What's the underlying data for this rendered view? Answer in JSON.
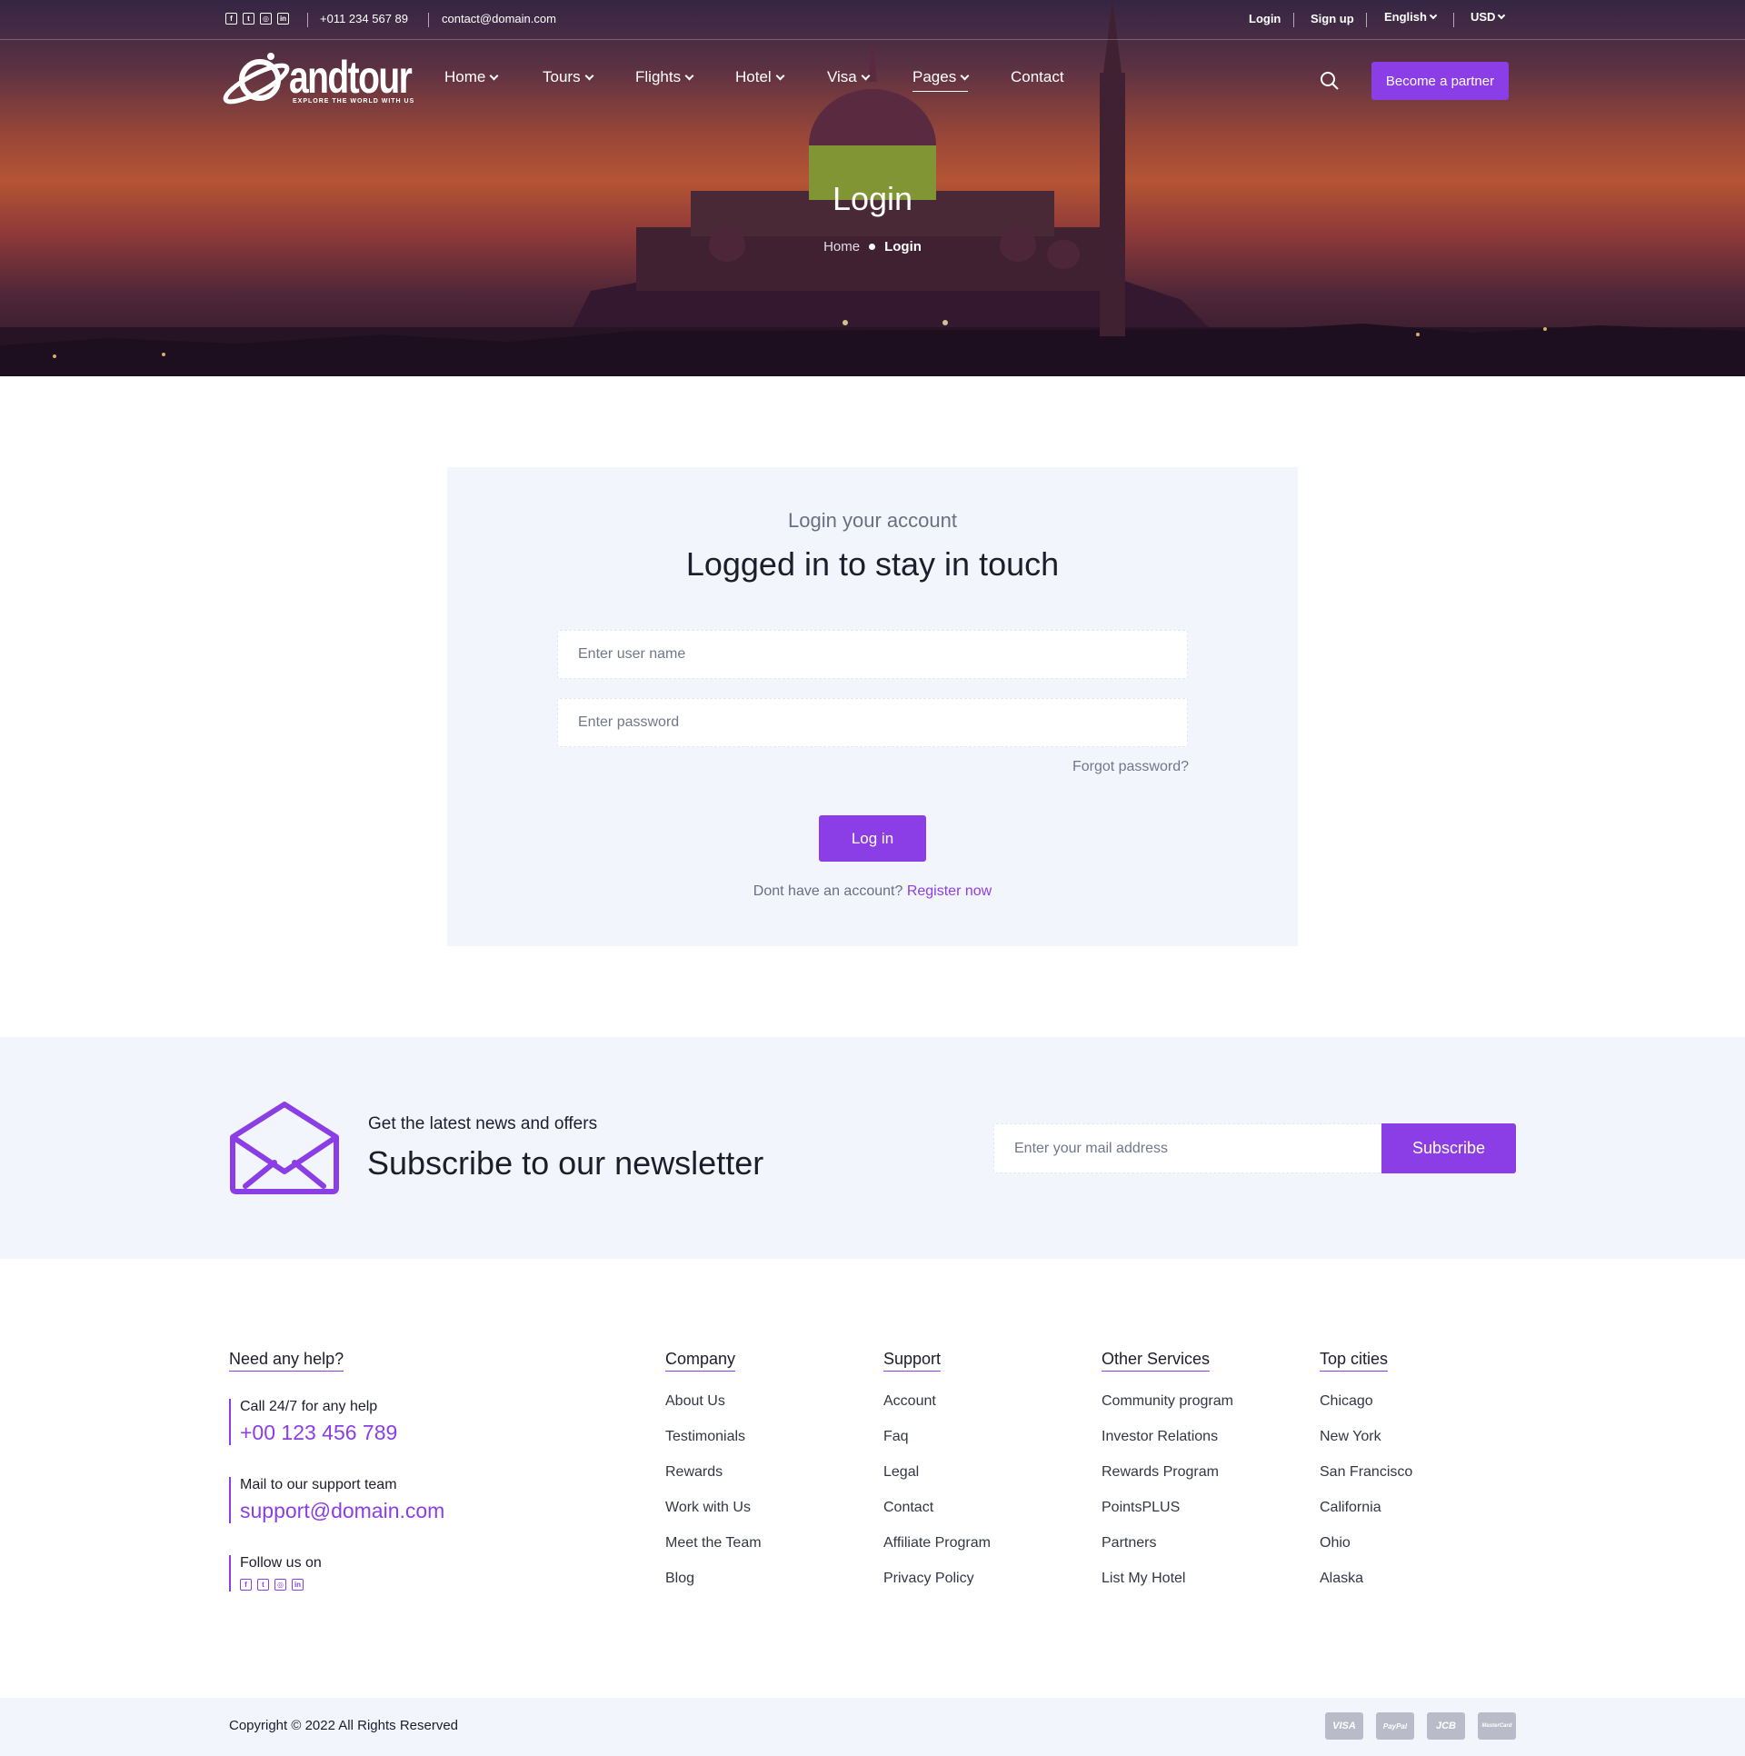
{
  "topbar": {
    "social_icons": [
      "facebook-icon",
      "twitter-icon",
      "instagram-icon",
      "linkedin-icon"
    ],
    "phone": "+011 234 567 89",
    "email": "contact@domain.com",
    "login": "Login",
    "signup": "Sign up",
    "language": "English",
    "currency": "USD"
  },
  "nav": {
    "logo_text": "andtour",
    "logo_tagline": "EXPLORE THE WORLD WITH US",
    "items": [
      {
        "label": "Home",
        "dropdown": true
      },
      {
        "label": "Tours",
        "dropdown": true
      },
      {
        "label": "Flights",
        "dropdown": true
      },
      {
        "label": "Hotel",
        "dropdown": true
      },
      {
        "label": "Visa",
        "dropdown": true
      },
      {
        "label": "Pages",
        "dropdown": true,
        "active": true
      },
      {
        "label": "Contact",
        "dropdown": false
      }
    ],
    "partner_button": "Become a partner"
  },
  "hero": {
    "title": "Login",
    "breadcrumb_home": "Home",
    "breadcrumb_current": "Login"
  },
  "login": {
    "subtitle": "Login your account",
    "title": "Logged in to stay in touch",
    "username_placeholder": "Enter user name",
    "password_placeholder": "Enter password",
    "forgot": "Forgot password?",
    "button": "Log in",
    "no_account": "Dont have an account?",
    "register": "Register now"
  },
  "newsletter": {
    "subtitle": "Get the latest news and offers",
    "title": "Subscribe to our newsletter",
    "placeholder": "Enter your mail address",
    "button": "Subscribe"
  },
  "footer": {
    "help": {
      "heading": "Need any help?",
      "call_label": "Call 24/7 for any help",
      "call_value": "+00 123 456 789",
      "mail_label": "Mail to our support team",
      "mail_value": "support@domain.com",
      "follow_label": "Follow us on"
    },
    "company": {
      "heading": "Company",
      "links": [
        "About Us",
        "Testimonials",
        "Rewards",
        "Work with Us",
        "Meet the Team",
        "Blog"
      ]
    },
    "support": {
      "heading": "Support",
      "links": [
        "Account",
        "Faq",
        "Legal",
        "Contact",
        "Affiliate Program",
        "Privacy Policy"
      ]
    },
    "services": {
      "heading": "Other Services",
      "links": [
        "Community program",
        "Investor Relations",
        "Rewards Program",
        "PointsPLUS",
        "Partners",
        "List My Hotel"
      ]
    },
    "cities": {
      "heading": "Top cities",
      "links": [
        "Chicago",
        "New York",
        "San Francisco",
        "California",
        "Ohio",
        "Alaska"
      ]
    },
    "copyright": "Copyright © 2022 All Rights Reserved",
    "payment_cards": [
      "VISA",
      "PayPal",
      "JCB",
      "MasterCard"
    ]
  },
  "colors": {
    "accent": "#8b3ee6",
    "panel_bg": "#f3f5fd",
    "text": "#1d1d2b"
  }
}
